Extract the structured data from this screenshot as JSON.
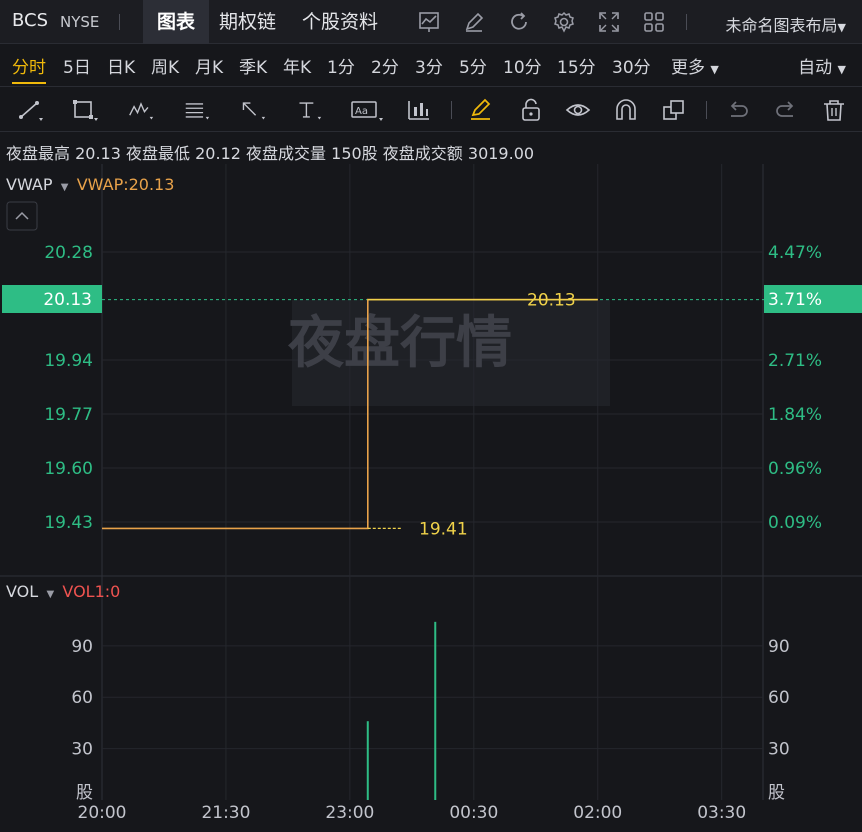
{
  "header": {
    "symbol": "BCS",
    "exchange": "NYSE",
    "tabs": [
      "图表",
      "期权链",
      "个股资料"
    ],
    "layout_name": "未命名图表布局",
    "icons": [
      "chart-icon",
      "edit-icon",
      "refresh-icon",
      "settings-icon",
      "fullscreen-icon",
      "grid-layout-icon"
    ]
  },
  "periods": {
    "items": [
      "分时",
      "5日",
      "日K",
      "周K",
      "月K",
      "季K",
      "年K",
      "1分",
      "2分",
      "3分",
      "5分",
      "10分",
      "15分",
      "30分",
      "更多"
    ],
    "active": "分时",
    "auto": "自动"
  },
  "tools": [
    "trend-line-icon",
    "rectangle-icon",
    "pattern-icon",
    "fib-icon",
    "arrow-icon",
    "text-icon",
    "note-icon",
    "measure-icon",
    "pencil-icon",
    "lock-icon",
    "eye-icon",
    "magnet-icon",
    "layers-icon",
    "undo-icon",
    "redo-icon",
    "trash-icon"
  ],
  "info": {
    "night_high_label": "夜盘最高",
    "night_high": "20.13",
    "night_low_label": "夜盘最低",
    "night_low": "20.12",
    "night_volume_label": "夜盘成交量",
    "night_volume": "150股",
    "night_amount_label": "夜盘成交额",
    "night_amount": "3019.00"
  },
  "price_panel": {
    "indicator": "VWAP",
    "indicator_value": "VWAP:20.13",
    "watermark": "夜盘行情",
    "current_price": "20.13",
    "current_pct": "3.71%",
    "high_marker": "20.13",
    "low_marker": "19.41"
  },
  "volume_panel": {
    "indicator": "VOL",
    "indicator_value": "VOL1:0",
    "unit": "股"
  },
  "colors": {
    "accent": "#f0b90b",
    "up": "#2ebd85",
    "price_line": "#e8a24a",
    "vol_label": "#ef5350",
    "background": "#16171b"
  },
  "chart_data": [
    {
      "type": "line",
      "series": [
        {
          "name": "VWAP",
          "x": [
            "20:00",
            "23:13",
            "23:13",
            "02:00"
          ],
          "values": [
            19.41,
            19.41,
            20.13,
            20.13
          ]
        }
      ],
      "xlabel": "",
      "ylabel": "",
      "x_ticks": [
        "20:00",
        "21:30",
        "23:00",
        "00:30",
        "02:00",
        "03:30"
      ],
      "y_ticks_left": [
        "20.28",
        "20.13",
        "19.94",
        "19.77",
        "19.60",
        "19.43"
      ],
      "y_ticks_right": [
        "4.47%",
        "3.71%",
        "2.71%",
        "1.84%",
        "0.96%",
        "0.09%"
      ],
      "ylim": [
        19.35,
        20.38
      ],
      "grid": true
    },
    {
      "type": "bar",
      "categories": [
        "23:13",
        "00:02"
      ],
      "values": [
        46,
        104
      ],
      "y_ticks": [
        "90",
        "60",
        "30",
        "股"
      ],
      "ylim": [
        0,
        115
      ],
      "grid": true
    }
  ]
}
